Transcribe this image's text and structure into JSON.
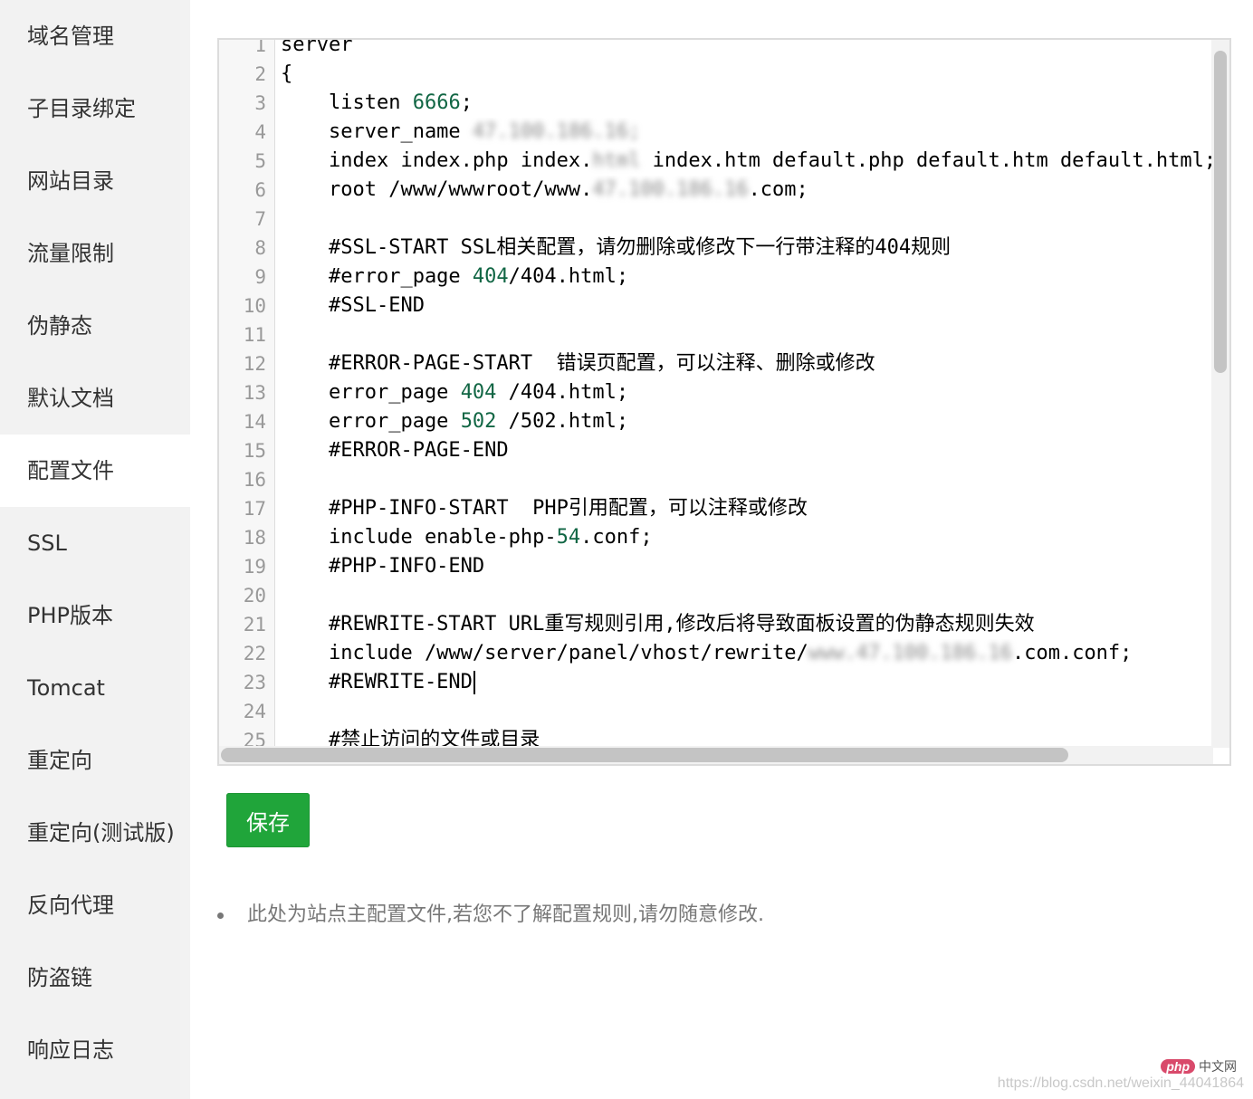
{
  "sidebar": {
    "items": [
      {
        "label": "域名管理"
      },
      {
        "label": "子目录绑定"
      },
      {
        "label": "网站目录"
      },
      {
        "label": "流量限制"
      },
      {
        "label": "伪静态"
      },
      {
        "label": "默认文档"
      },
      {
        "label": "配置文件"
      },
      {
        "label": "SSL"
      },
      {
        "label": "PHP版本"
      },
      {
        "label": "Tomcat"
      },
      {
        "label": "重定向"
      },
      {
        "label": "重定向(测试版)"
      },
      {
        "label": "反向代理"
      },
      {
        "label": "防盗链"
      },
      {
        "label": "响应日志"
      }
    ],
    "active_index": 6
  },
  "editor": {
    "lines": [
      {
        "n": "1",
        "parts": [
          {
            "t": "server"
          }
        ]
      },
      {
        "n": "2",
        "parts": [
          {
            "t": "{"
          }
        ]
      },
      {
        "n": "3",
        "parts": [
          {
            "t": "    listen "
          },
          {
            "t": "6666",
            "c": "num"
          },
          {
            "t": ";"
          }
        ]
      },
      {
        "n": "4",
        "parts": [
          {
            "t": "    server_name "
          },
          {
            "t": "47.100.186.16;",
            "c": "blur"
          }
        ]
      },
      {
        "n": "5",
        "parts": [
          {
            "t": "    index index.php index."
          },
          {
            "t": "html",
            "c": "blur"
          },
          {
            "t": " index.htm default.php default.htm default.html;"
          }
        ]
      },
      {
        "n": "6",
        "parts": [
          {
            "t": "    root /www/wwwroot/www."
          },
          {
            "t": "47.100.186.16",
            "c": "blur"
          },
          {
            "t": ".com;"
          }
        ]
      },
      {
        "n": "7",
        "parts": [
          {
            "t": ""
          }
        ]
      },
      {
        "n": "8",
        "parts": [
          {
            "t": "    #SSL-START SSL相关配置，请勿删除或修改下一行带注释的404规则"
          }
        ]
      },
      {
        "n": "9",
        "parts": [
          {
            "t": "    #error_page "
          },
          {
            "t": "404",
            "c": "num"
          },
          {
            "t": "/404.html;"
          }
        ]
      },
      {
        "n": "10",
        "parts": [
          {
            "t": "    #SSL-END"
          }
        ]
      },
      {
        "n": "11",
        "parts": [
          {
            "t": ""
          }
        ]
      },
      {
        "n": "12",
        "parts": [
          {
            "t": "    #ERROR-PAGE-START  错误页配置，可以注释、删除或修改"
          }
        ]
      },
      {
        "n": "13",
        "parts": [
          {
            "t": "    error_page "
          },
          {
            "t": "404",
            "c": "num"
          },
          {
            "t": " /404.html;"
          }
        ]
      },
      {
        "n": "14",
        "parts": [
          {
            "t": "    error_page "
          },
          {
            "t": "502",
            "c": "num"
          },
          {
            "t": " /502.html;"
          }
        ]
      },
      {
        "n": "15",
        "parts": [
          {
            "t": "    #ERROR-PAGE-END"
          }
        ]
      },
      {
        "n": "16",
        "parts": [
          {
            "t": ""
          }
        ]
      },
      {
        "n": "17",
        "parts": [
          {
            "t": "    #PHP-INFO-START  PHP引用配置，可以注释或修改"
          }
        ]
      },
      {
        "n": "18",
        "parts": [
          {
            "t": "    include enable-php-"
          },
          {
            "t": "54",
            "c": "num"
          },
          {
            "t": ".conf;"
          }
        ]
      },
      {
        "n": "19",
        "parts": [
          {
            "t": "    #PHP-INFO-END"
          }
        ]
      },
      {
        "n": "20",
        "parts": [
          {
            "t": ""
          }
        ]
      },
      {
        "n": "21",
        "parts": [
          {
            "t": "    #REWRITE-START URL重写规则引用,修改后将导致面板设置的伪静态规则失效"
          }
        ]
      },
      {
        "n": "22",
        "parts": [
          {
            "t": "    include /www/server/panel/vhost/rewrite/"
          },
          {
            "t": "www.47.100.186.16",
            "c": "blur"
          },
          {
            "t": ".com.conf;"
          }
        ]
      },
      {
        "n": "23",
        "parts": [
          {
            "t": "    #REWRITE-END"
          },
          {
            "t": "",
            "c": "caret"
          }
        ]
      },
      {
        "n": "24",
        "parts": [
          {
            "t": ""
          }
        ]
      },
      {
        "n": "25",
        "parts": [
          {
            "t": "    #禁止访问的文件或目录"
          }
        ]
      }
    ]
  },
  "save_label": "保存",
  "tip": "此处为站点主配置文件,若您不了解配置规则,请勿随意修改.",
  "watermark": {
    "url": "https://blog.csdn.net/weixin_44041864",
    "logo_php": "php",
    "logo_text": "中文网"
  },
  "colors": {
    "accent": "#20a53a",
    "number": "#116644",
    "sidebar_bg": "#f2f2f2"
  }
}
